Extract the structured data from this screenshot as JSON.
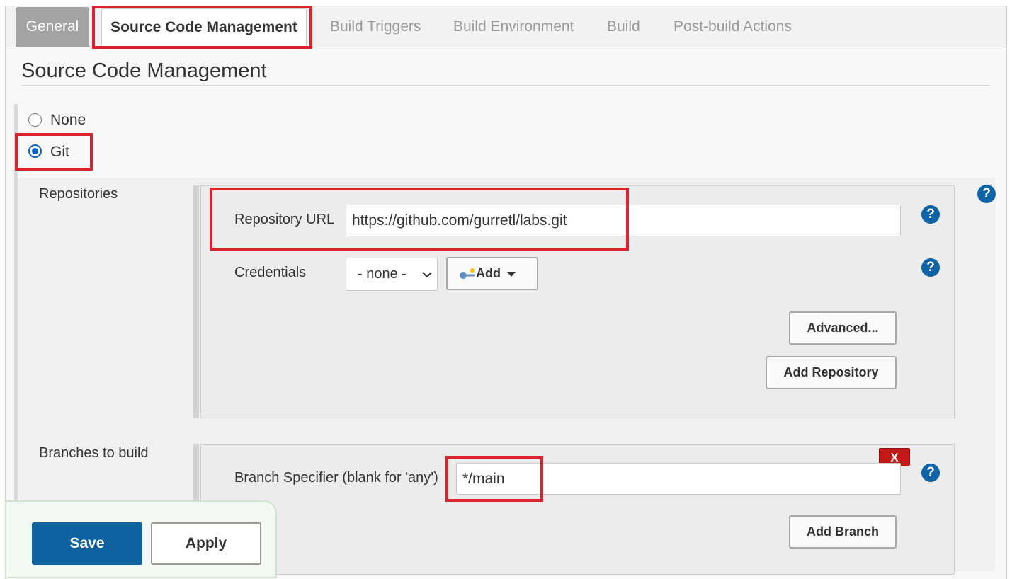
{
  "tabs": [
    {
      "label": "General"
    },
    {
      "label": "Source Code Management"
    },
    {
      "label": "Build Triggers"
    },
    {
      "label": "Build Environment"
    },
    {
      "label": "Build"
    },
    {
      "label": "Post-build Actions"
    }
  ],
  "section": {
    "title": "Source Code Management"
  },
  "scm_options": {
    "none_label": "None",
    "git_label": "Git",
    "selected": "Git"
  },
  "repositories": {
    "label": "Repositories",
    "repo_url_label": "Repository URL",
    "repo_url_value": "https://github.com/gurretl/labs.git",
    "credentials_label": "Credentials",
    "credentials_selected": "- none -",
    "add_label": "Add",
    "advanced_label": "Advanced...",
    "add_repository_label": "Add Repository"
  },
  "branches": {
    "label": "Branches to build",
    "specifier_label": "Branch Specifier (blank for 'any')",
    "specifier_value": "*/main",
    "delete_label": "X",
    "add_branch_label": "Add Branch"
  },
  "help_glyph": "?",
  "footer": {
    "save_label": "Save",
    "apply_label": "Apply"
  },
  "colors": {
    "primary": "#0e62a0",
    "highlight": "#d9232f",
    "delete": "#c41818"
  }
}
